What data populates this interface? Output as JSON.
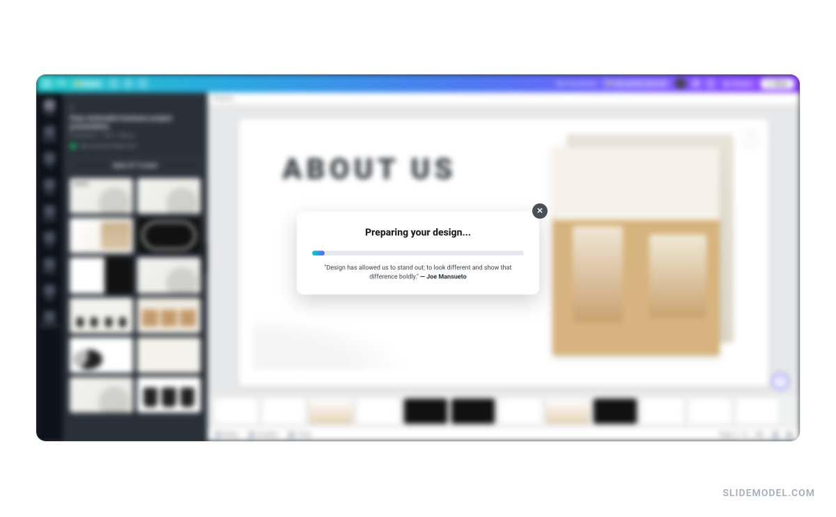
{
  "topbar": {
    "menu_file": "File",
    "resize_label": "Resize",
    "doc_title": "My Presentation",
    "trial_label": "Get another free trial",
    "present_label": "Present",
    "share_label": "Share"
  },
  "rail": {
    "items": [
      "Design",
      "Elements",
      "Text",
      "Brand",
      "Uploads",
      "Draw",
      "Projects",
      "Apps",
      "Background"
    ]
  },
  "panel": {
    "template_title": "Gray minimalist business project presentation",
    "template_subtitle": "Presentation • 1920 × 1080 px",
    "author_label": "View more by Infinity Form",
    "apply_label": "Apply all 14 pages"
  },
  "canvas": {
    "position_label": "Position",
    "slide_title": "ABOUT US",
    "help_label": "?"
  },
  "bottombar": {
    "notes": "Notes",
    "duration": "Duration",
    "timer": "Timer",
    "page_label": "Page 2 / 14",
    "zoom": "38%"
  },
  "modal": {
    "title": "Preparing your design...",
    "quote": "\"Design has allowed us to stand out; to look different and show that difference boldly.\"",
    "quote_attr": " — Joe Mansueto",
    "progress_pct": "6%"
  },
  "watermark": "SLIDEMODEL.COM"
}
